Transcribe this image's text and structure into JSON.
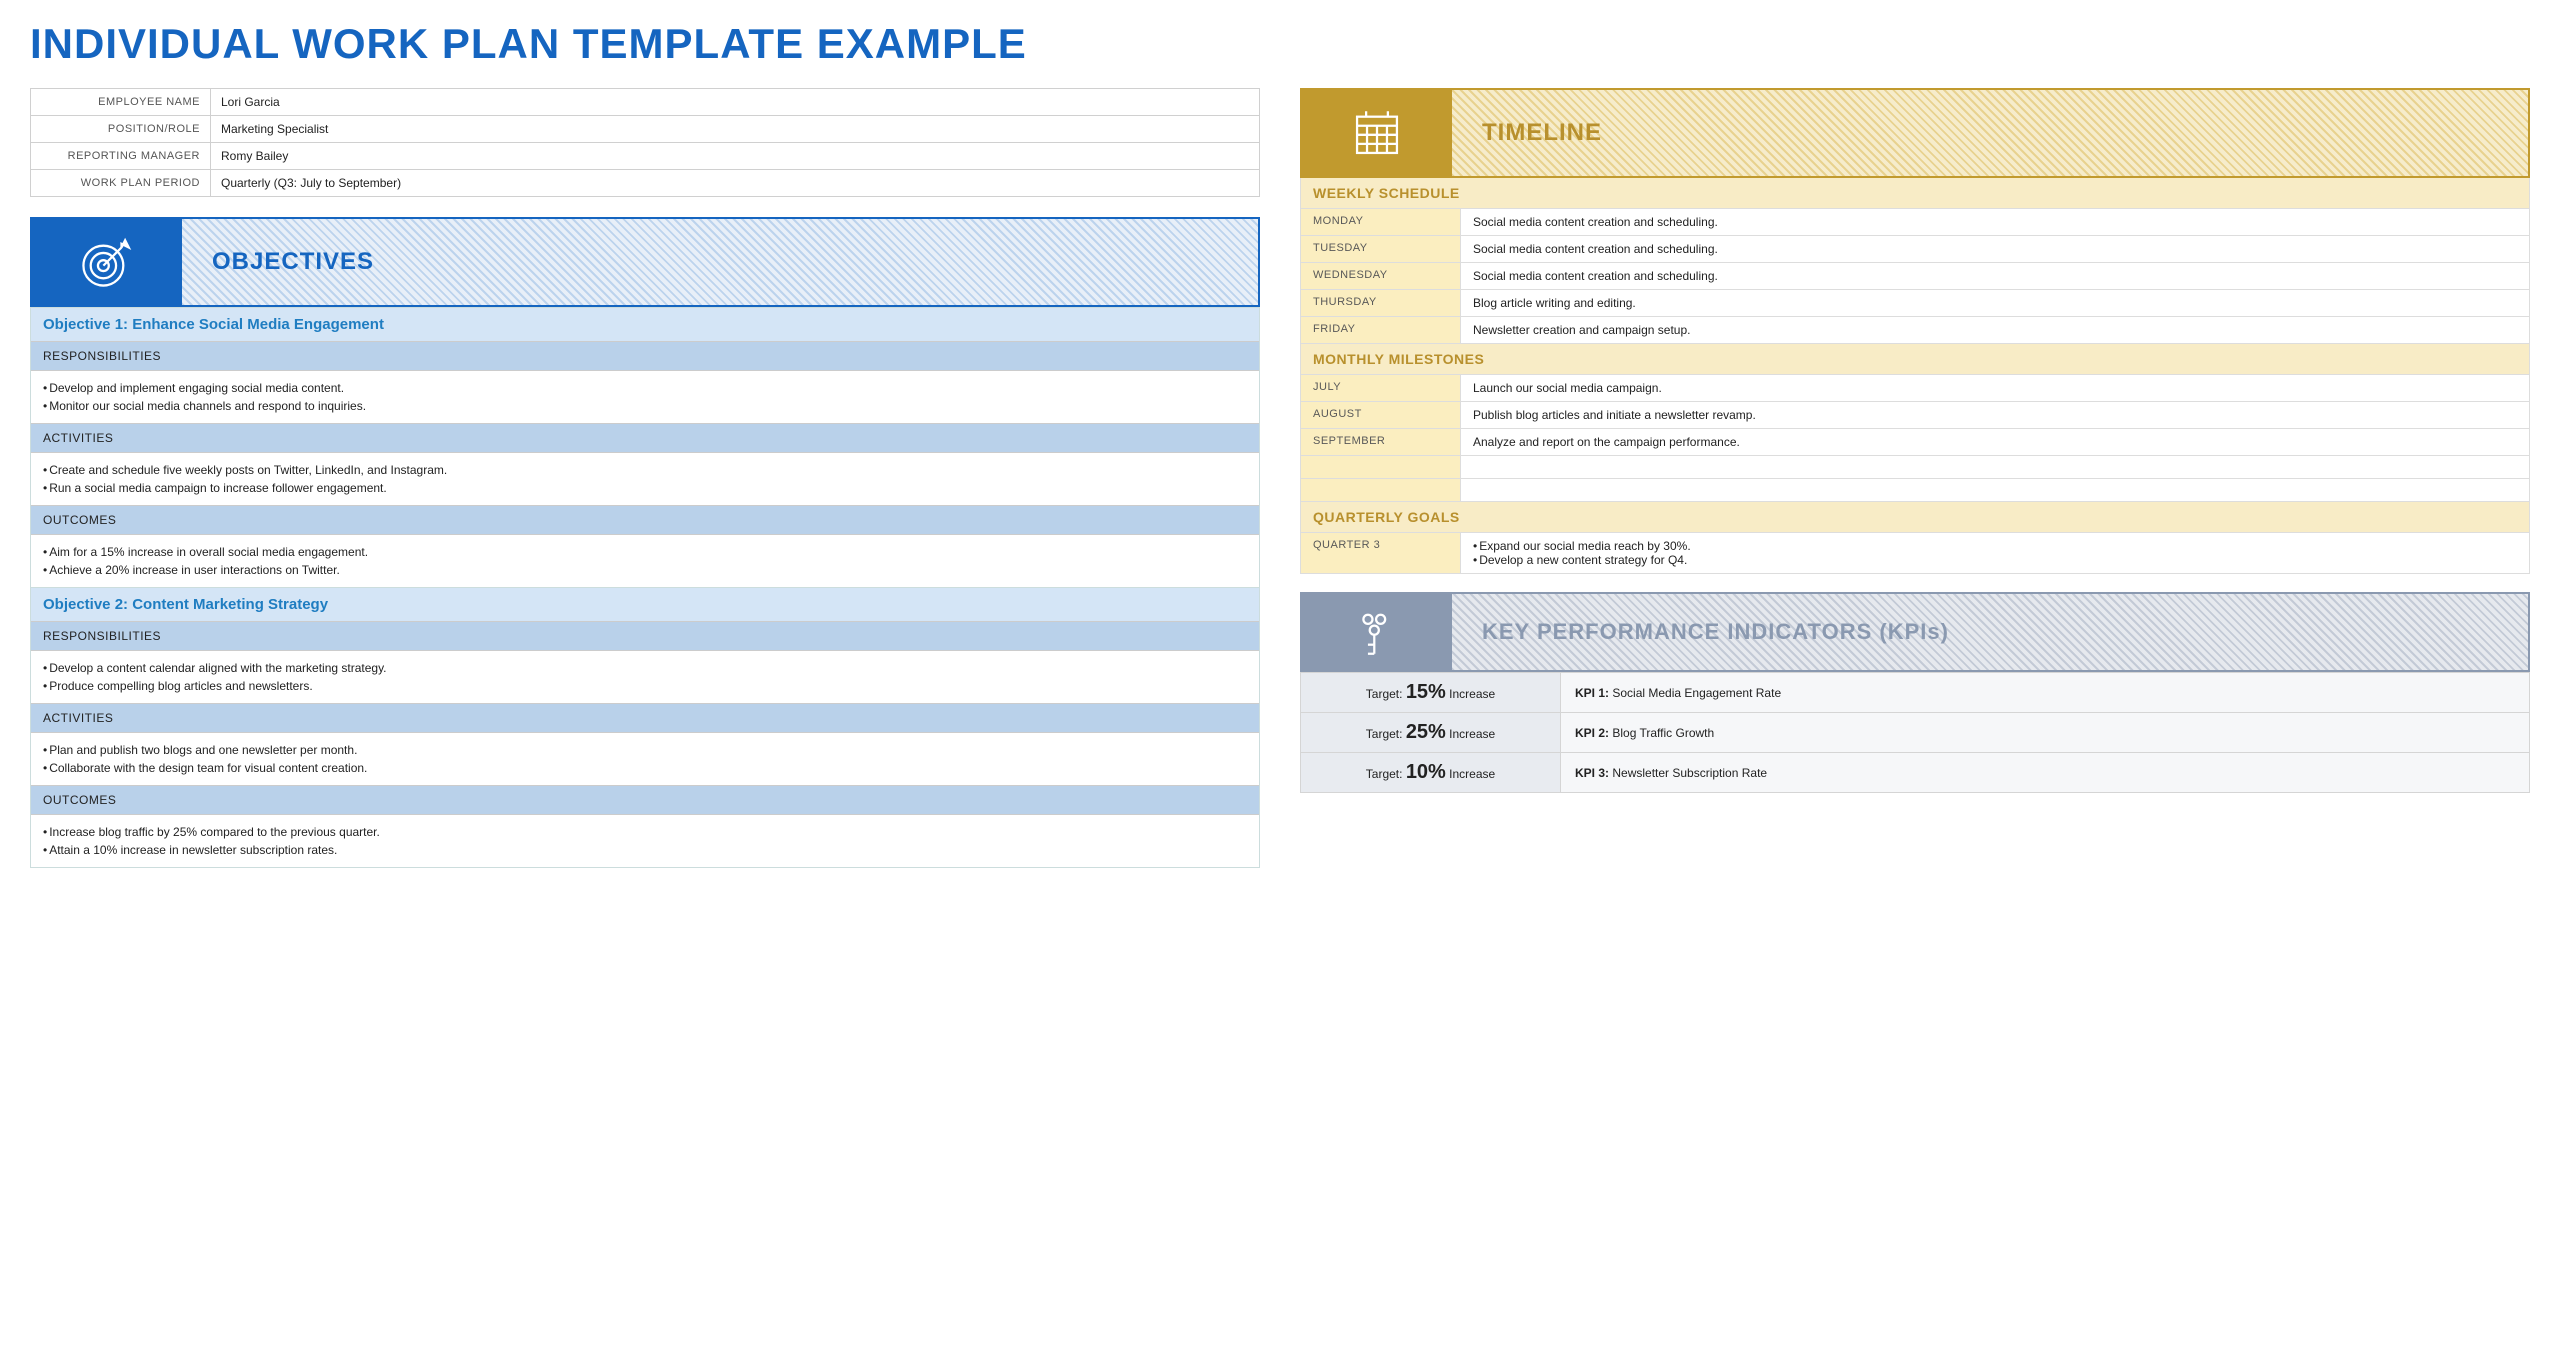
{
  "title": "INDIVIDUAL WORK PLAN TEMPLATE EXAMPLE",
  "info": {
    "rows": [
      {
        "label": "EMPLOYEE NAME",
        "value": "Lori Garcia"
      },
      {
        "label": "POSITION/ROLE",
        "value": "Marketing Specialist"
      },
      {
        "label": "REPORTING MANAGER",
        "value": "Romy Bailey"
      },
      {
        "label": "WORK PLAN PERIOD",
        "value": "Quarterly (Q3: July to September)"
      }
    ]
  },
  "objectives": {
    "header": "OBJECTIVES",
    "items": [
      {
        "title": "Objective 1: Enhance Social Media Engagement",
        "responsibilities_label": "RESPONSIBILITIES",
        "responsibilities": [
          "Develop and implement engaging social media content.",
          "Monitor our social media channels and respond to inquiries."
        ],
        "activities_label": "ACTIVITIES",
        "activities": [
          "Create and schedule five weekly posts on Twitter, LinkedIn, and Instagram.",
          "Run a social media campaign to increase follower engagement."
        ],
        "outcomes_label": "OUTCOMES",
        "outcomes": [
          "Aim for a 15% increase in overall social media engagement.",
          "Achieve a 20% increase in user interactions on Twitter."
        ]
      },
      {
        "title": "Objective 2: Content Marketing Strategy",
        "responsibilities_label": "RESPONSIBILITIES",
        "responsibilities": [
          "Develop a content calendar aligned with the marketing strategy.",
          "Produce compelling blog articles and newsletters."
        ],
        "activities_label": "ACTIVITIES",
        "activities": [
          "Plan and publish two blogs and one newsletter per month.",
          "Collaborate with the design team for visual content creation."
        ],
        "outcomes_label": "OUTCOMES",
        "outcomes": [
          "Increase blog traffic by 25% compared to the previous quarter.",
          "Attain a 10% increase in newsletter subscription rates."
        ]
      }
    ]
  },
  "timeline": {
    "header": "TIMELINE",
    "weekly_label": "WEEKLY SCHEDULE",
    "weekly": [
      {
        "day": "MONDAY",
        "task": "Social media content creation and scheduling."
      },
      {
        "day": "TUESDAY",
        "task": "Social media content creation and scheduling."
      },
      {
        "day": "WEDNESDAY",
        "task": "Social media content creation and scheduling."
      },
      {
        "day": "THURSDAY",
        "task": "Blog article writing and editing."
      },
      {
        "day": "FRIDAY",
        "task": "Newsletter creation and campaign setup."
      }
    ],
    "monthly_label": "MONTHLY MILESTONES",
    "monthly": [
      {
        "month": "JULY",
        "task": "Launch our social media campaign."
      },
      {
        "month": "AUGUST",
        "task": "Publish blog articles and initiate a newsletter revamp."
      },
      {
        "month": "SEPTEMBER",
        "task": "Analyze and report on the campaign performance."
      }
    ],
    "quarterly_label": "QUARTERLY GOALS",
    "quarterly": {
      "quarter": "QUARTER 3",
      "goals": [
        "Expand our social media reach by 30%.",
        "Develop a new content strategy for Q4."
      ]
    }
  },
  "kpi": {
    "header": "KEY PERFORMANCE INDICATORS (KPIs)",
    "target_label": "Target:",
    "increase_label": "Increase",
    "items": [
      {
        "pct": "15%",
        "num": "KPI 1:",
        "name": "Social Media Engagement Rate"
      },
      {
        "pct": "25%",
        "num": "KPI 2:",
        "name": "Blog Traffic Growth"
      },
      {
        "pct": "10%",
        "num": "KPI 3:",
        "name": "Newsletter Subscription Rate"
      }
    ]
  }
}
